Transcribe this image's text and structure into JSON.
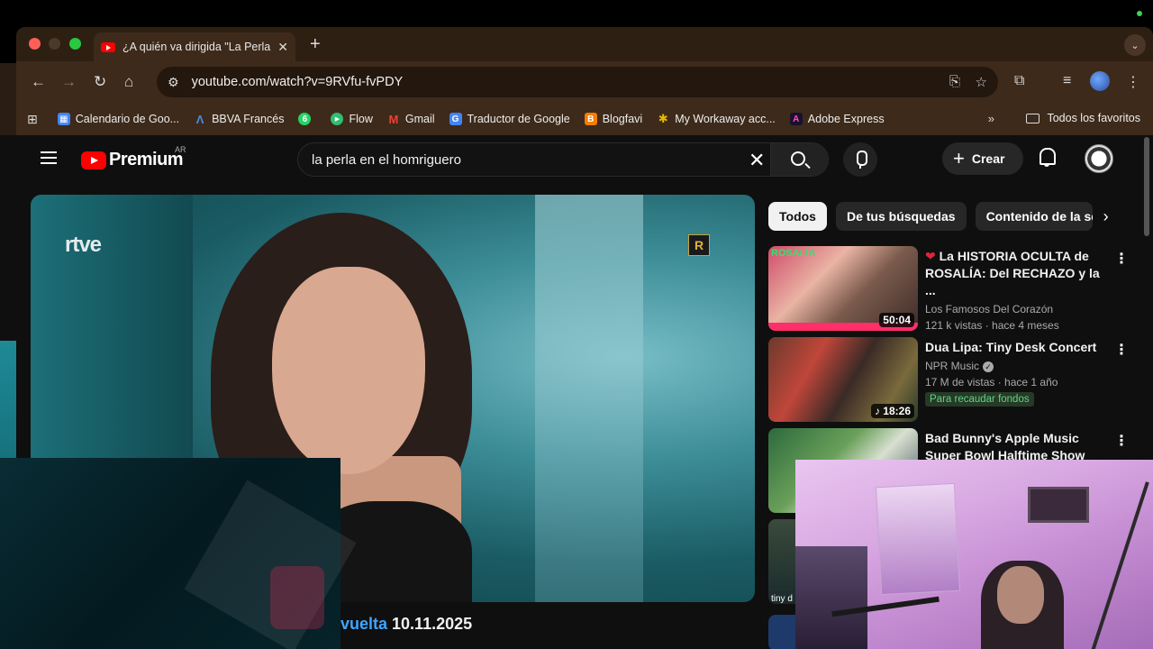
{
  "browser": {
    "tab_title": "¿A quién va dirigida \"La Perla",
    "tab_close": "✕",
    "new_tab": "+",
    "tab_menu": "⌄",
    "url": "youtube.com/watch?v=9RVfu-fvPDY",
    "bookmarks": [
      {
        "label": "Calendario de Goo...",
        "icon": "calendar-icon",
        "color": "#4285f4",
        "glyph": "▦"
      },
      {
        "label": "BBVA Francés",
        "icon": "bbva-icon",
        "color": "#1464a5",
        "glyph": "Λ"
      },
      {
        "label": "",
        "icon": "whatsapp-icon",
        "color": "#25d366",
        "glyph": "6"
      },
      {
        "label": "Flow",
        "icon": "flow-icon",
        "color": "#2fbf71",
        "glyph": "▶"
      },
      {
        "label": "Gmail",
        "icon": "gmail-icon",
        "color": "#ea4335",
        "glyph": "M"
      },
      {
        "label": "Traductor de Google",
        "icon": "translate-icon",
        "color": "#4285f4",
        "glyph": "G"
      },
      {
        "label": "Blogfavi",
        "icon": "blogger-icon",
        "color": "#f57d00",
        "glyph": "B"
      },
      {
        "label": "My Workaway acc...",
        "icon": "workaway-icon",
        "color": "#e6b800",
        "glyph": "✱"
      },
      {
        "label": "Adobe Express",
        "icon": "adobe-express-icon",
        "color": "#7a3cff",
        "glyph": "A"
      }
    ],
    "bookmarks_more": "»",
    "all_bookmarks": "Todos los favoritos"
  },
  "youtube": {
    "brand": "Premium",
    "country": "AR",
    "search_query": "la perla en el homriguero",
    "create_label": "Crear",
    "player": {
      "watermark": "rtve",
      "corner_badge": "R"
    },
    "video_title_highlight": "vuelta",
    "video_title_rest": " 10.11.2025",
    "chips": [
      "Todos",
      "De tus búsquedas",
      "Contenido de la ser"
    ],
    "recommendations": [
      {
        "title_prefix": "❤",
        "title": " La HISTORIA OCULTA de ROSALÍA: Del RECHAZO y la ...",
        "channel": "Los Famosos Del Corazón",
        "meta": "121 k vistas · hace 4 meses",
        "duration": "50:04",
        "thumb_label": "ROSALÍA"
      },
      {
        "title": "Dua Lipa: Tiny Desk Concert",
        "channel": "NPR Music",
        "meta": "17 M de vistas · hace 1 año",
        "badge": "Para recaudar fondos",
        "duration": "♪ 18:26"
      },
      {
        "title": "Bad Bunny's Apple Music Super Bowl Halftime Show"
      },
      {
        "thumb_label": "tiny d"
      }
    ]
  }
}
